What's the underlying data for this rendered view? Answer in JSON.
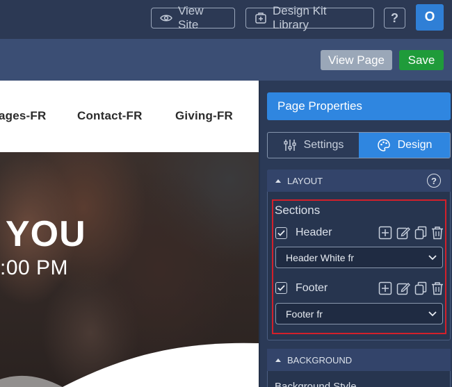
{
  "topbar": {
    "view_site_label": "View Site",
    "design_kit_label": "Design Kit Library",
    "help_label": "?",
    "avatar_initial": "O"
  },
  "toolbar": {
    "view_page_label": "View Page",
    "save_label": "Save"
  },
  "preview": {
    "nav_items": [
      "ages-FR",
      "Contact-FR",
      "Giving-FR"
    ],
    "hero_title": "YOU",
    "hero_time": ":00 PM"
  },
  "panel": {
    "page_properties_label": "Page Properties",
    "tabs": [
      {
        "label": "Settings",
        "icon": "sliders-icon",
        "active": false
      },
      {
        "label": "Design",
        "icon": "palette-icon",
        "active": true
      }
    ],
    "layout": {
      "header_label": "LAYOUT",
      "help_label": "?",
      "sections_title": "Sections",
      "rows": [
        {
          "label": "Header",
          "checked": true,
          "select_value": "Header White fr"
        },
        {
          "label": "Footer",
          "checked": true,
          "select_value": "Footer fr"
        }
      ]
    },
    "background": {
      "header_label": "BACKGROUND",
      "peek_text": "Background Style"
    }
  },
  "colors": {
    "accent": "#2f86e0",
    "save": "#1f9b3a",
    "highlight": "#d3202a"
  }
}
